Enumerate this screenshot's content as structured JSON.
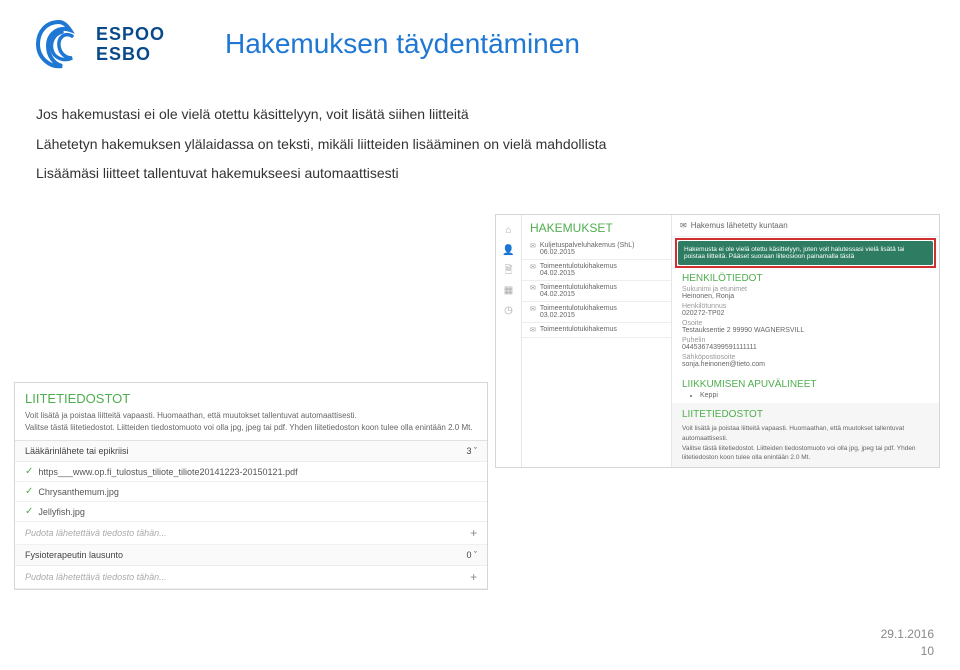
{
  "logo": {
    "line1": "ESPOO",
    "line2": "ESBO"
  },
  "pageTitle": "Hakemuksen täydentäminen",
  "intro": {
    "p1": "Jos hakemustasi ei ole vielä otettu käsittelyyn, voit lisätä siihen liitteitä",
    "p2": "Lähetetyn hakemuksen ylälaidassa on teksti, mikäli liitteiden lisääminen on vielä mahdollista",
    "p3": "Lisäämäsi liitteet tallentuvat hakemukseesi automaattisesti"
  },
  "rightShot": {
    "sectionTitle": "HAKEMUKSET",
    "apps": [
      {
        "name": "Kuljetuspalveluhakemus (ShL)",
        "date": "06.02.2015"
      },
      {
        "name": "Toimeentulotukihakemus",
        "date": "04.02.2015"
      },
      {
        "name": "Toimeentulotukihakemus",
        "date": "04.02.2015"
      },
      {
        "name": "Toimeentulotukihakemus",
        "date": "03.02.2015"
      },
      {
        "name": "Toimeentulotukihakemus",
        "date": ""
      }
    ],
    "sentLabel": "Hakemus lähetetty kuntaan",
    "notice": "Hakemusta ei ole vielä otettu käsittelyyn, joten voit halutessasi vielä lisätä tai poistaa liitteitä. Pääset suoraan liiteosioon painamalla tästä",
    "personHeader": "HENKILÖTIEDOT",
    "person": {
      "nameLabel": "Sukunimi ja etunimet",
      "nameVal": "Heinonen, Ronja",
      "idLabel": "Henkilötunnus",
      "idVal": "020272-TP02",
      "addrLabel": "Osoite",
      "addrVal": "Testauksentie 2 99990 WAGNERSVILL",
      "phoneLabel": "Puhelin",
      "phoneVal": "04453674399591111111",
      "emailLabel": "Sähköpostiosoite",
      "emailVal": "sonja.heinonen@tieto.com"
    },
    "aidsHeader": "LIIKKUMISEN APUVÄLINEET",
    "aidsItem": "Keppi",
    "liiteHeader": "LIITETIEDOSTOT",
    "liiteDesc1": "Voit lisätä ja poistaa liitteitä vapaasti. Huomaathan, että muutokset tallentuvat automaattisesti.",
    "liiteDesc2": "Valitse tästä liitetiedostot. Liitteiden tiedostomuoto voi olla jpg, jpeg tai pdf. Yhden liitetiedoston koon tulee olla enintään 2.0 Mt."
  },
  "leftShot": {
    "header": "LIITETIEDOSTOT",
    "desc1": "Voit lisätä ja poistaa liitteitä vapaasti. Huomaathan, että muutokset tallentuvat automaattisesti.",
    "desc2": "Valitse tästä liitetiedostot. Liitteiden tiedostomuoto voi olla jpg, jpeg tai pdf. Yhden liitetiedoston koon tulee olla enintään 2.0 Mt.",
    "group1": {
      "title": "Lääkärinlähete tai epikriisi",
      "count": "3"
    },
    "files": [
      "https___www.op.fi_tulostus_tiliote_tiliote20141223-20150121.pdf",
      "Chrysanthemum.jpg",
      "Jellyfish.jpg"
    ],
    "dropHint": "Pudota lähetettävä tiedosto tähän...",
    "group2": {
      "title": "Fysioterapeutin lausunto",
      "count": "0"
    },
    "dropHint2": "Pudota lähetettävä tiedosto tähän...",
    "chev": "ˇ",
    "plus": "+"
  },
  "footer": {
    "date": "29.1.2016",
    "page": "10"
  }
}
